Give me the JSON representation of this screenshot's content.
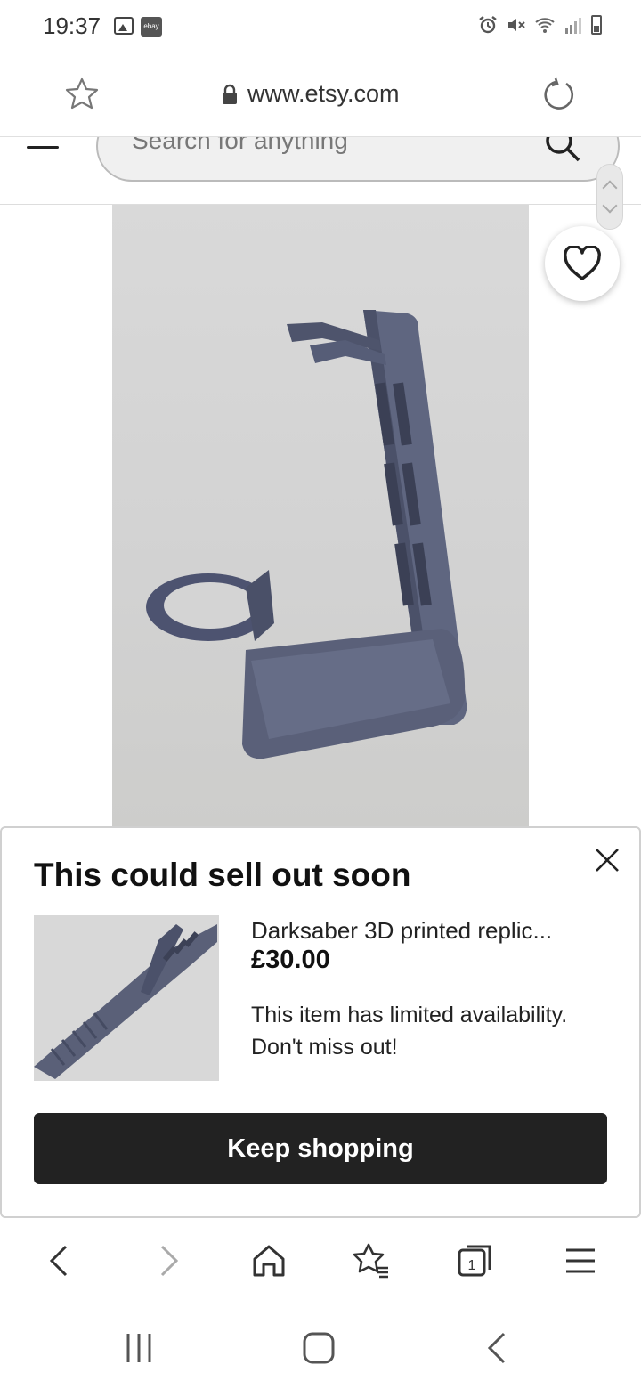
{
  "status_bar": {
    "time": "19:37",
    "left_icons": [
      "gallery-icon",
      "ebay-icon"
    ],
    "ebay_label": "ebay",
    "right_icons": [
      "alarm-icon",
      "mute-icon",
      "wifi-icon",
      "signal-icon",
      "battery-icon"
    ]
  },
  "browser": {
    "url": "www.etsy.com",
    "icons": {
      "bookmark": "star-icon",
      "secure": "lock-icon",
      "reload": "reload-icon"
    }
  },
  "etsy_header": {
    "search_placeholder": "Search for anything"
  },
  "product": {
    "image_description_icon": "favorite-heart-icon"
  },
  "modal": {
    "title": "This could sell out soon",
    "item_name": "Darksaber 3D printed replic...",
    "price": "£30.00",
    "note": "This item has limited availability. Don't miss out!",
    "button_label": "Keep shopping"
  },
  "browser_nav": {
    "items": [
      "back-icon",
      "forward-icon",
      "home-icon",
      "bookmarks-icon",
      "tabs-icon",
      "menu-icon"
    ],
    "tab_count": "1"
  },
  "system_nav": {
    "items": [
      "recents-icon",
      "home-icon",
      "back-icon"
    ]
  }
}
